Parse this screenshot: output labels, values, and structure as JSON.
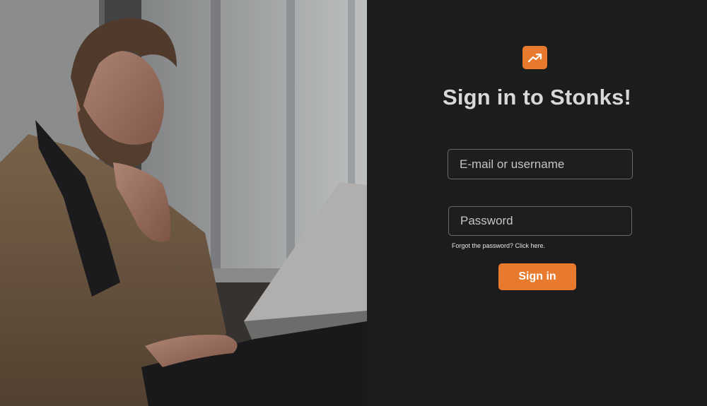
{
  "brand": {
    "logo_icon": "trending-up-icon",
    "accent_color": "#e87a2e"
  },
  "login": {
    "title": "Sign in to Stonks!",
    "email_placeholder": "E-mail or username",
    "password_placeholder": "Password",
    "forgot_text": "Forgot the password? Click here.",
    "signin_label": "Sign in"
  },
  "hero": {
    "image": "man-with-laptop-photo"
  }
}
